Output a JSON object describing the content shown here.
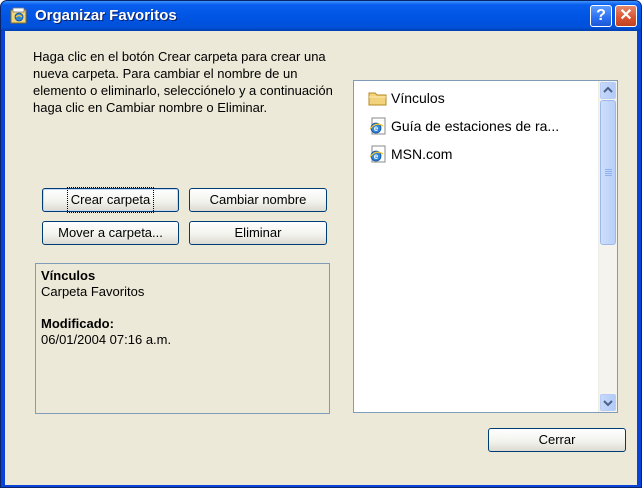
{
  "window": {
    "title": "Organizar Favoritos",
    "help_label": "?",
    "close_label": "✕"
  },
  "instructions": "Haga clic en el botón Crear carpeta para crear una nueva carpeta. Para cambiar el nombre de un elemento o eliminarlo, selecciónelo y a continuación haga clic en Cambiar nombre o Eliminar.",
  "buttons": {
    "create_folder": "Crear carpeta",
    "rename": "Cambiar nombre",
    "move_to_folder": "Mover a carpeta...",
    "delete": "Eliminar",
    "close": "Cerrar"
  },
  "details": {
    "name": "Vínculos",
    "type": "Carpeta Favoritos",
    "modified_label": "Modificado:",
    "modified_value": "06/01/2004 07:16 a.m."
  },
  "list": {
    "items": [
      {
        "label": "Vínculos",
        "icon": "folder-icon"
      },
      {
        "label": "Guía de estaciones de ra...",
        "icon": "ie-page-icon"
      },
      {
        "label": "MSN.com",
        "icon": "ie-page-icon"
      }
    ]
  },
  "colors": {
    "titlebar": "#0054e3",
    "face": "#ece9d8",
    "close_button": "#d8532f",
    "border": "#7f9db9"
  }
}
